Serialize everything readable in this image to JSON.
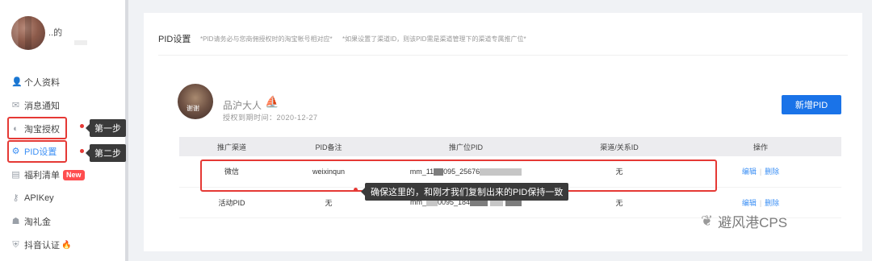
{
  "sidebar": {
    "username": "..的",
    "items": [
      {
        "label": "个人资料",
        "icon": "person-icon"
      },
      {
        "label": "消息通知",
        "icon": "mail-icon"
      },
      {
        "label": "淘宝授权",
        "icon": "taobao-icon"
      },
      {
        "label": "PID设置",
        "icon": "gear-icon"
      },
      {
        "label": "福利清单",
        "icon": "list-icon",
        "badge": "New"
      },
      {
        "label": "APIKey",
        "icon": "key-icon"
      },
      {
        "label": "淘礼金",
        "icon": "gift-icon"
      },
      {
        "label": "抖音认证",
        "icon": "shield-icon"
      }
    ],
    "step1": "第一步",
    "step2": "第二步"
  },
  "main": {
    "title": "PID设置",
    "note1": "*PID请务必与您商佣授权时的淘宝帐号相对应*",
    "note2": "*如果设置了渠道ID，则该PID需是渠道管理下的渠道专属推广位*",
    "shop": {
      "name": "品沪大人",
      "avatar_text": "谢谢",
      "auth_time": "授权到期时间：2020-12-27"
    },
    "add_button": "新增PID",
    "table": {
      "headers": [
        "推广渠道",
        "PID备注",
        "推广位PID",
        "渠道/关系ID",
        "操作"
      ],
      "rows": [
        {
          "channel": "微信",
          "remark": "weixinqun",
          "pid_prefix": "mm_11",
          "pid_mid": "095_25676",
          "pid_suffix": "",
          "relation": "无",
          "edit": "编辑",
          "delete": "删除"
        },
        {
          "channel": "活动PID",
          "remark": "无",
          "pid_prefix": "mm_",
          "pid_mid": "0095_184",
          "pid_suffix": "",
          "relation": "无",
          "edit": "编辑",
          "delete": "删除"
        }
      ]
    },
    "hint": "确保这里的，和刚才我们复制出来的PID保持一致"
  },
  "watermark": "避风港CPS",
  "colors": {
    "accent": "#1a73e8",
    "highlight": "#e53935",
    "link": "#3b8ff5"
  }
}
